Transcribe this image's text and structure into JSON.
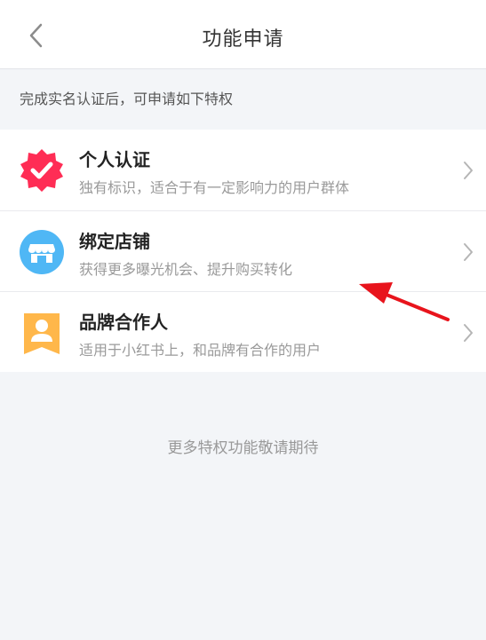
{
  "header": {
    "title": "功能申请"
  },
  "tip": "完成实名认证后，可申请如下特权",
  "items": [
    {
      "title": "个人认证",
      "desc": "独有标识，适合于有一定影响力的用户群体",
      "icon": "verified-badge-icon",
      "color": "#ff2d55"
    },
    {
      "title": "绑定店铺",
      "desc": "获得更多曝光机会、提升购买转化",
      "icon": "store-icon",
      "color": "#4fb7f5"
    },
    {
      "title": "品牌合作人",
      "desc": "适用于小红书上，和品牌有合作的用户",
      "icon": "person-card-icon",
      "color": "#ffb74a"
    }
  ],
  "footer": "更多特权功能敬请期待",
  "annotation": {
    "color": "#e8141c"
  }
}
